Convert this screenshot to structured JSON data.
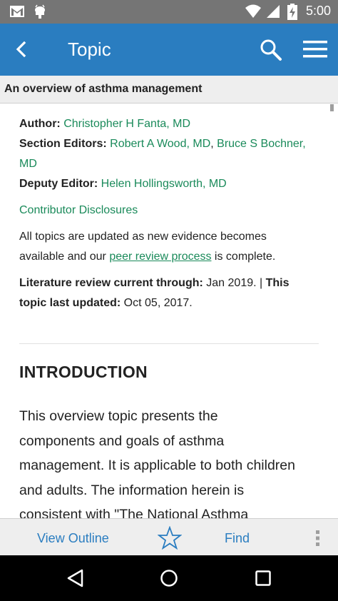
{
  "status_bar": {
    "time": "5:00",
    "icons": [
      "gmail-icon",
      "android-debug-icon",
      "wifi-icon",
      "signal-icon",
      "battery-charging-icon"
    ]
  },
  "app_bar": {
    "title": "Topic",
    "icons": [
      "back-arrow-icon",
      "search-icon",
      "hamburger-menu-icon"
    ]
  },
  "topic": {
    "title": "An overview of asthma management"
  },
  "meta": {
    "author_label": "Author:",
    "author": "Christopher H Fanta, MD",
    "section_editors_label": "Section Editors:",
    "section_editor_1": "Robert A Wood, MD",
    "separator": ",",
    "section_editor_2_part1": "Bruce S Bochner,",
    "section_editor_2_part2": "MD",
    "deputy_editor_label": "Deputy Editor:",
    "deputy_editor": "Helen Hollingsworth, MD",
    "contributor_disclosures": "Contributor Disclosures",
    "update_line1": "All topics are updated as new evidence becomes",
    "update_line2_pre": "available and our ",
    "peer_review_link": "peer review process",
    "update_line2_post": " is complete.",
    "lit_review_label": "Literature review current through:",
    "lit_review_value": " Jan 2019. | ",
    "last_updated_label_part1": "This",
    "last_updated_label_part2": "topic last updated:",
    "last_updated_value": " Oct 05, 2017."
  },
  "section": {
    "heading": "INTRODUCTION",
    "lines": [
      "This overview topic presents the",
      "components and goals of asthma",
      "management. It is applicable to both children",
      "and adults. The information herein is",
      "consistent with \"The National Asthma"
    ]
  },
  "bottom_bar": {
    "view_outline": "View Outline",
    "find": "Find",
    "icons": [
      "star-icon",
      "more-vert-icon"
    ]
  },
  "nav_bar": {
    "icons": [
      "nav-back-icon",
      "nav-home-icon",
      "nav-recents-icon"
    ]
  },
  "colors": {
    "app_bar": "#2a7dc0",
    "link_green": "#1a8a5a",
    "status_bar": "#757575"
  }
}
